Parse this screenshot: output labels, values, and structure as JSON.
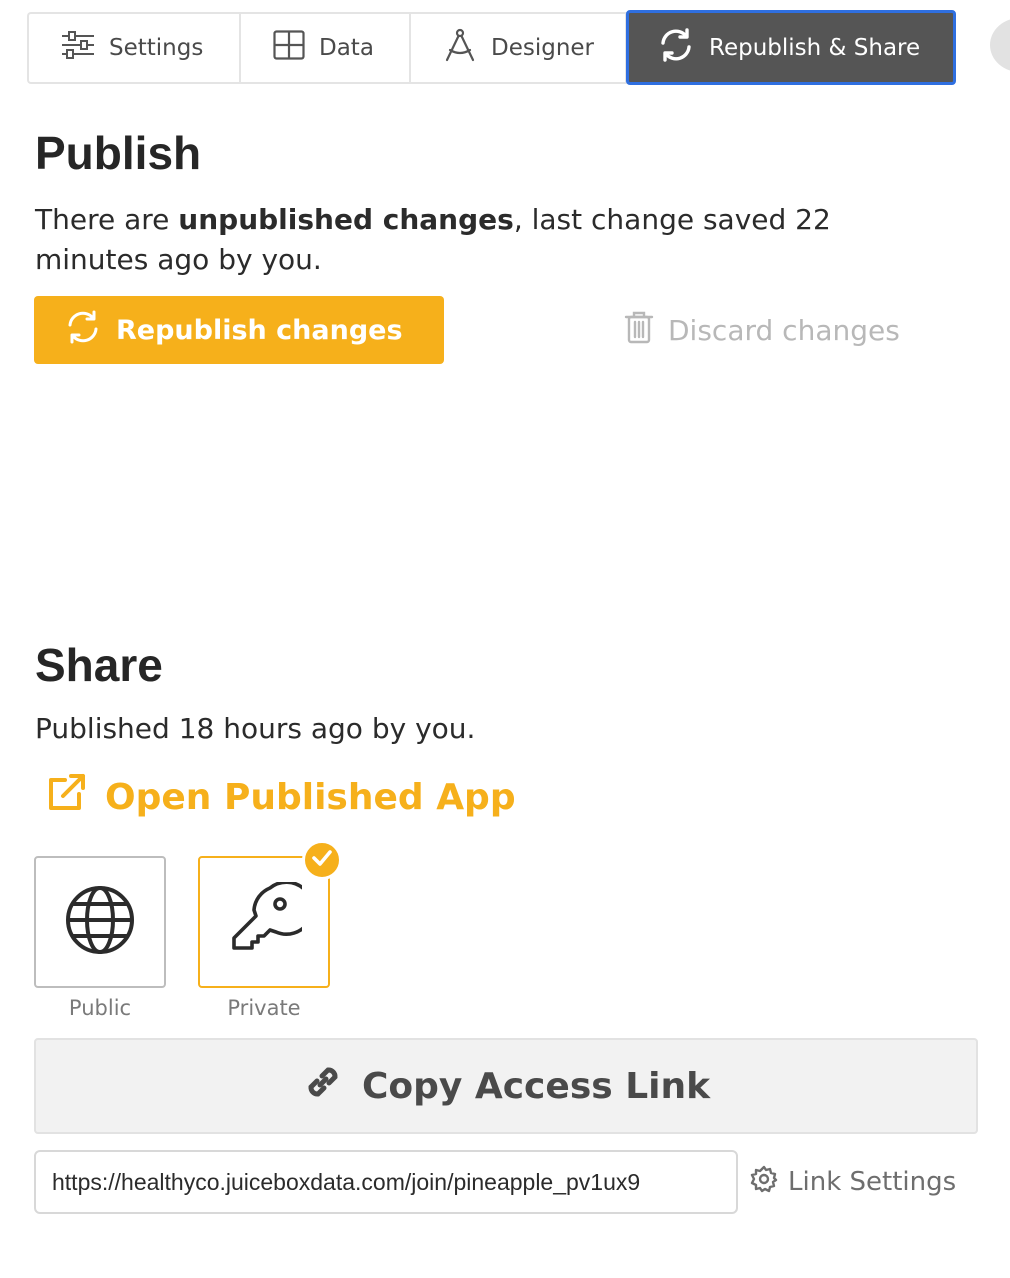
{
  "tabs": {
    "settings": "Settings",
    "data": "Data",
    "designer": "Designer",
    "republish_share": "Republish & Share"
  },
  "publish": {
    "title": "Publish",
    "desc_prefix": "There are ",
    "desc_bold": "unpublished changes",
    "desc_suffix": ", last change saved 22 minutes ago by you.",
    "republish_label": "Republish changes",
    "discard_label": "Discard changes"
  },
  "share": {
    "title": "Share",
    "desc": "Published 18 hours ago by you.",
    "open_app_label": "Open Published App",
    "visibility": {
      "public_label": "Public",
      "private_label": "Private",
      "selected": "Private"
    },
    "copy_link_label": "Copy Access Link",
    "access_link": "https://healthyco.juiceboxdata.com/join/pineapple_pv1ux9",
    "link_settings_label": "Link Settings"
  },
  "colors": {
    "accent": "#f6b01b",
    "active_tab_bg": "#555555",
    "active_tab_border": "#2f6fe0",
    "disabled_text": "#b8b8b8"
  },
  "icons": {
    "settings": "sliders-icon",
    "data": "grid-icon",
    "designer": "compass-icon",
    "republish": "refresh-icon",
    "discard": "trash-icon",
    "open_app": "external-link-icon",
    "public": "globe-icon",
    "private": "key-icon",
    "selected": "check-icon",
    "copy_link": "link-icon",
    "link_settings": "gear-icon"
  }
}
